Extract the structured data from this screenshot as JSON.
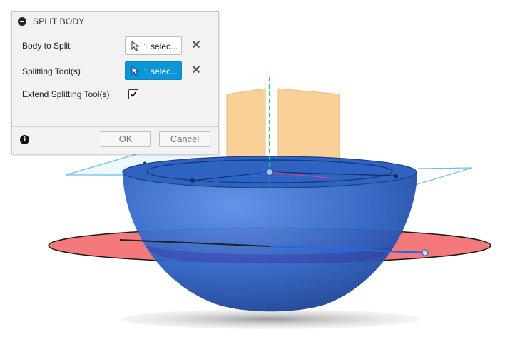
{
  "panel": {
    "title": "SPLIT BODY",
    "rows": {
      "body_to_split": {
        "label": "Body to Split",
        "selection": "1 selec..."
      },
      "splitting_tools": {
        "label": "Splitting Tool(s)",
        "selection": "1 selec..."
      },
      "extend": {
        "label": "Extend Splitting Tool(s)",
        "checked": true
      }
    },
    "ok_label": "OK",
    "cancel_label": "Cancel",
    "clear_glyph": "✕",
    "info_glyph": "i"
  },
  "colors": {
    "sphere_blue": "#2f68c8",
    "sketch_red": "#f0787a",
    "tool_orange": "#f7c98a",
    "plane_cyan": "#7ec8e6",
    "axis_green": "#2bd14a",
    "selection_blue": "#0a96d8"
  }
}
